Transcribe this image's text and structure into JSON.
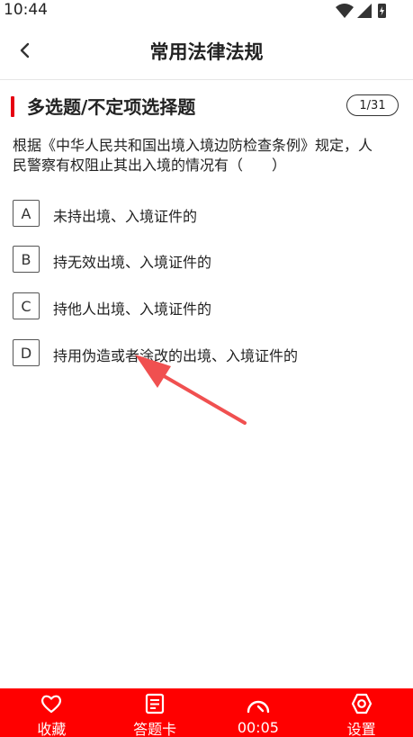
{
  "status": {
    "time": "10:44"
  },
  "header": {
    "title": "常用法律法规"
  },
  "question": {
    "type": "多选题/不定项选择题",
    "counter": "1/31",
    "text": "根据《中华人民共和国出境入境边防检查条例》规定，人民警察有权阻止其出入境的情况有（　　）",
    "options": [
      {
        "letter": "A",
        "text": "未持出境、入境证件的"
      },
      {
        "letter": "B",
        "text": "持无效出境、入境证件的"
      },
      {
        "letter": "C",
        "text": "持他人出境、入境证件的"
      },
      {
        "letter": "D",
        "text": "持用伪造或者涂改的出境、入境证件的"
      }
    ]
  },
  "bottom_nav": {
    "items": [
      {
        "label": "收藏",
        "icon": "heart-icon"
      },
      {
        "label": "答题卡",
        "icon": "answer-sheet-icon"
      },
      {
        "label": "00:05",
        "icon": "timer-icon"
      },
      {
        "label": "设置",
        "icon": "settings-icon"
      }
    ]
  },
  "colors": {
    "accent": "#e60012",
    "bottom_bar": "#ff0000",
    "annotation_arrow": "#f05050"
  }
}
